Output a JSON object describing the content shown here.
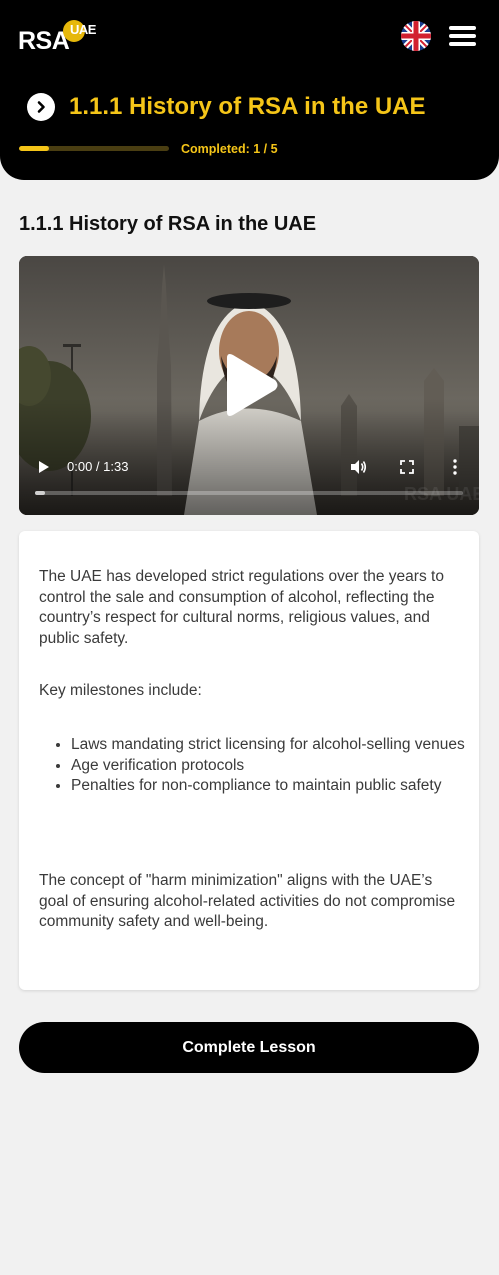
{
  "header": {
    "logo_main": "RSA",
    "logo_badge": "UAE",
    "language_icon": "uk-flag-icon",
    "menu_icon": "hamburger-menu-icon",
    "back_icon": "chevron-right-icon",
    "title": "1.1.1 History of RSA in the UAE",
    "progress": {
      "text": "Completed: 1 / 5",
      "fraction": 0.2
    },
    "accent_color": "#f5c518"
  },
  "lesson": {
    "title": "1.1.1 History of RSA in the UAE"
  },
  "video": {
    "time": "0:00 / 1:33",
    "watermark": "RSA UAE",
    "icons": [
      "play-icon",
      "volume-icon",
      "fullscreen-icon",
      "more-options-icon"
    ]
  },
  "content": {
    "paragraph1": "The UAE has developed strict regulations over the years to control the sale and consumption of alcohol, reflecting the country’s respect for cultural norms, religious values, and public safety.",
    "paragraph2": "Key milestones include:",
    "milestones": [
      "Laws mandating strict licensing for alcohol-selling venues",
      "Age verification protocols",
      "Penalties for non-compliance to maintain public safety"
    ],
    "paragraph3": "The concept of \"harm minimization\" aligns with the UAE’s goal of ensuring alcohol-related activities do not compromise community safety and well-being."
  },
  "actions": {
    "complete_label": "Complete Lesson"
  }
}
